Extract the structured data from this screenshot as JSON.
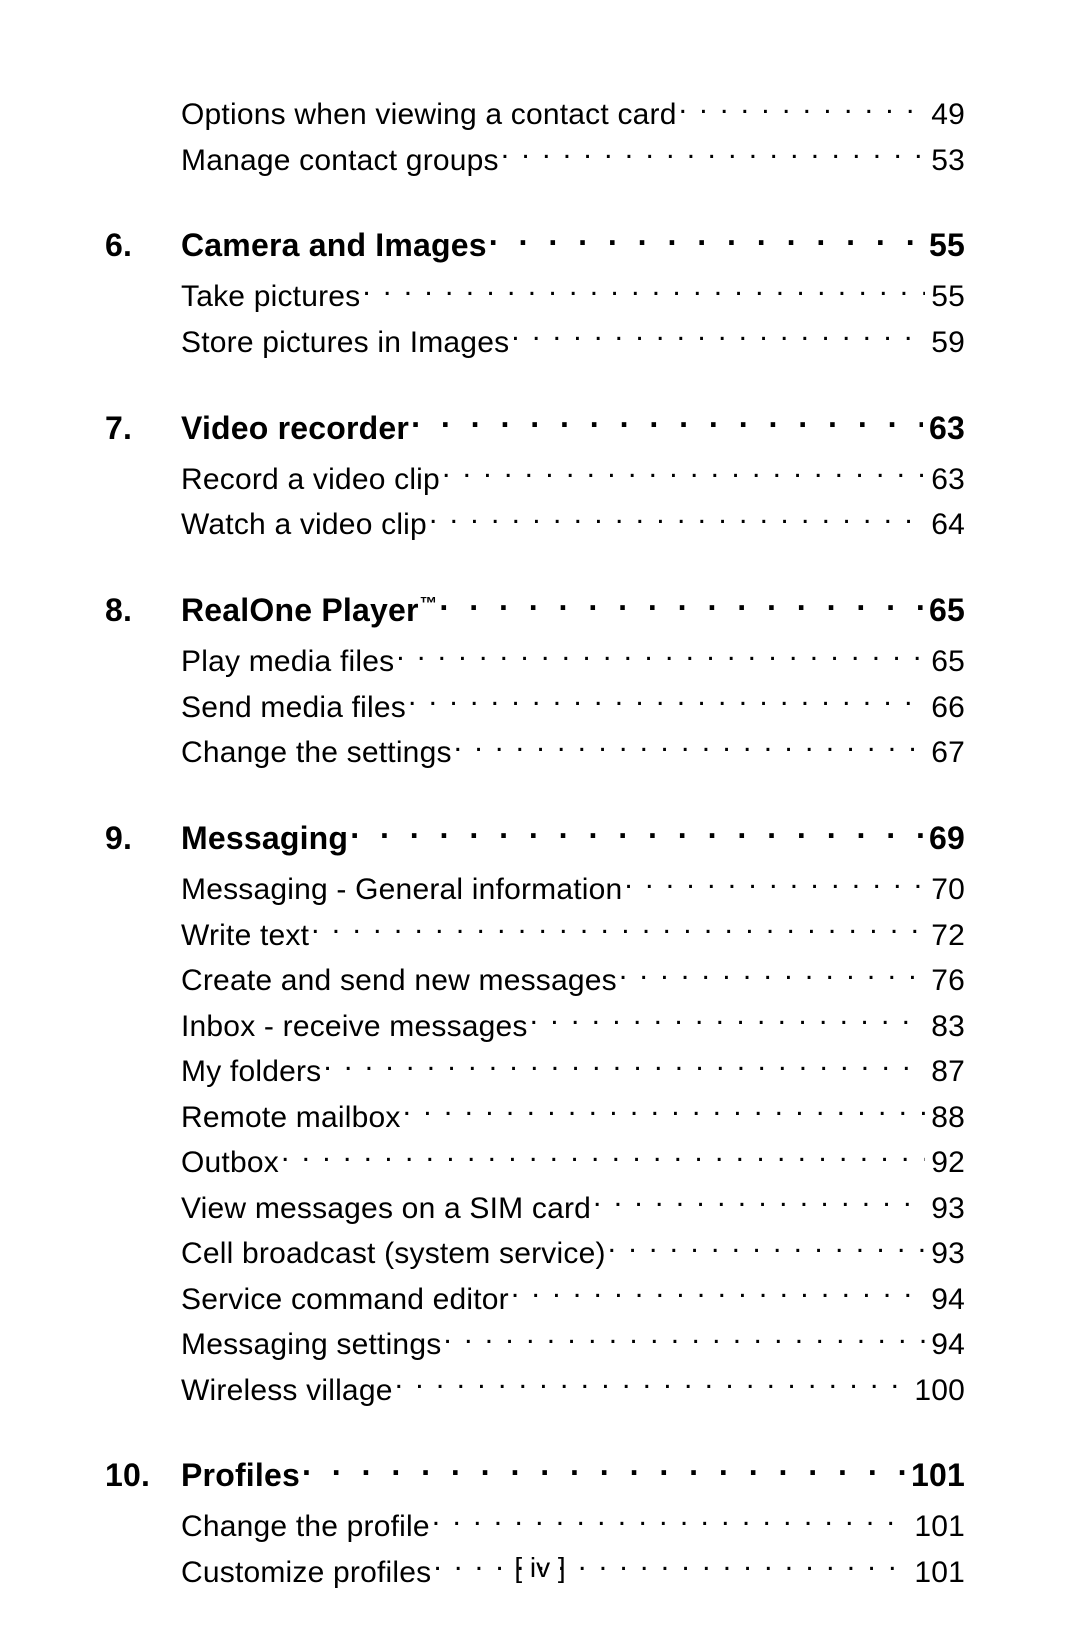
{
  "page_label": "[ iv ]",
  "orphan_entries": [
    {
      "title": "Options when viewing a contact card",
      "page": "49"
    },
    {
      "title": "Manage contact groups",
      "page": "53"
    }
  ],
  "chapters": [
    {
      "num": "6.",
      "title": "Camera and Images",
      "page": "55",
      "entries": [
        {
          "title": "Take pictures",
          "page": "55"
        },
        {
          "title": "Store pictures in Images",
          "page": "59"
        }
      ]
    },
    {
      "num": "7.",
      "title": "Video recorder",
      "page": "63",
      "entries": [
        {
          "title": "Record a video clip",
          "page": "63"
        },
        {
          "title": "Watch a video clip",
          "page": "64"
        }
      ]
    },
    {
      "num": "8.",
      "title": "RealOne Player",
      "title_suffix_tm": "™",
      "page": "65",
      "entries": [
        {
          "title": "Play media files",
          "page": "65"
        },
        {
          "title": "Send media files",
          "page": "66"
        },
        {
          "title": "Change the settings",
          "page": "67"
        }
      ]
    },
    {
      "num": "9.",
      "title": "Messaging",
      "page": "69",
      "entries": [
        {
          "title": "Messaging - General information",
          "page": "70"
        },
        {
          "title": "Write text",
          "page": "72"
        },
        {
          "title": "Create and send new messages",
          "page": "76"
        },
        {
          "title": "Inbox - receive messages",
          "page": "83"
        },
        {
          "title": "My folders",
          "page": "87"
        },
        {
          "title": "Remote mailbox",
          "page": "88"
        },
        {
          "title": "Outbox",
          "page": "92"
        },
        {
          "title": "View messages on a SIM card",
          "page": "93"
        },
        {
          "title": "Cell broadcast (system service)",
          "page": "93"
        },
        {
          "title": "Service command editor",
          "page": "94"
        },
        {
          "title": "Messaging settings",
          "page": "94"
        },
        {
          "title": "Wireless village",
          "page": "100"
        }
      ]
    },
    {
      "num": "10.",
      "title": "Profiles",
      "page": "101",
      "entries": [
        {
          "title": "Change the profile",
          "page": "101"
        },
        {
          "title": "Customize profiles",
          "page": "101"
        }
      ]
    }
  ]
}
